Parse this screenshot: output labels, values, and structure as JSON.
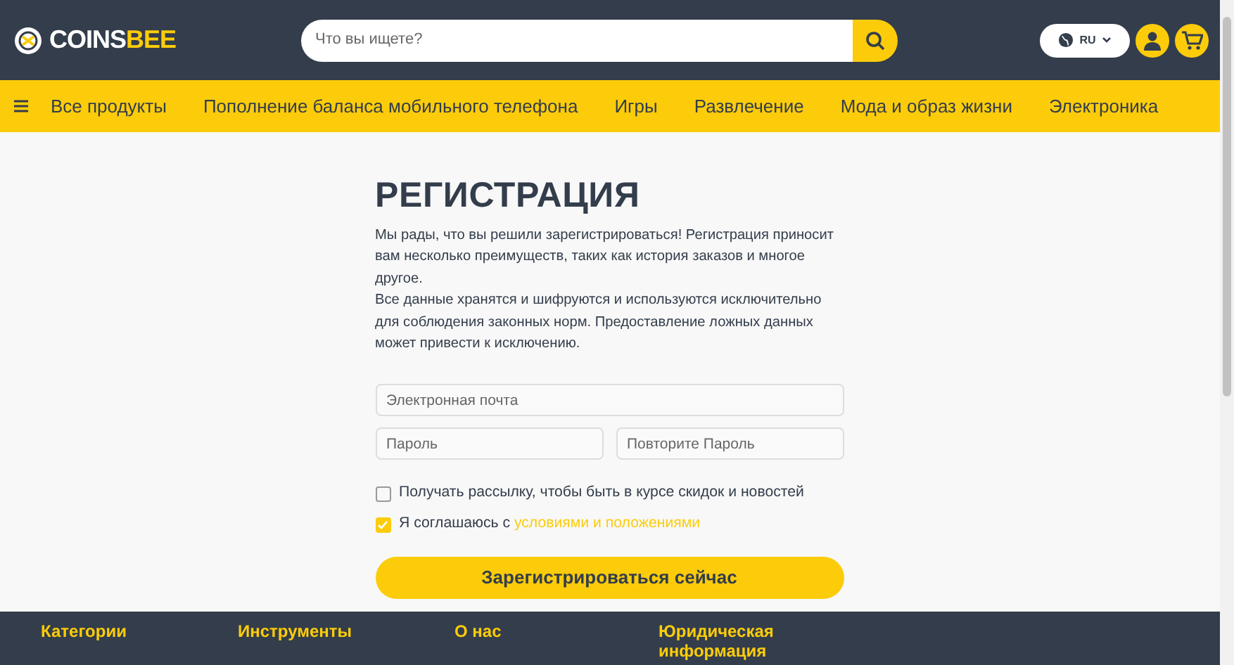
{
  "header": {
    "logo": {
      "part_1": "COINS",
      "part_2": "BEE"
    },
    "search": {
      "placeholder": "Что вы ищете?"
    },
    "language": "RU"
  },
  "nav": {
    "items": [
      {
        "label": "Все продукты"
      },
      {
        "label": "Пополнение баланса мобильного телефона"
      },
      {
        "label": "Игры"
      },
      {
        "label": "Развлечение"
      },
      {
        "label": "Мода и образ жизни"
      },
      {
        "label": "Электроника"
      }
    ]
  },
  "form": {
    "title": "РЕГИСТРАЦИЯ",
    "paragraphs": [
      "Мы рады, что вы решили зарегистрироваться! Регистрация приносит вам несколько преимуществ, таких как история заказов и многое другое.",
      "Все данные хранятся и шифруются и используются исключительно для соблюдения законных норм. Предоставление ложных данных может привести к исключению."
    ],
    "fields": [
      {
        "placeholder": "Электронная почта"
      },
      {
        "placeholder": "Пароль"
      },
      {
        "placeholder": "Повторите Пароль"
      }
    ],
    "checkboxes": [
      {
        "label": "Получать рассылку, чтобы быть в курсе скидок и новостей",
        "checked": false
      },
      {
        "label": "Я соглашаюсь с ",
        "link": "условиями и положениями",
        "checked": true
      }
    ],
    "submit": "Зарегистрироваться сейчас"
  },
  "footer": {
    "headings": [
      "Категории",
      "Инструменты",
      "О нас",
      "Юридическая информация"
    ]
  }
}
